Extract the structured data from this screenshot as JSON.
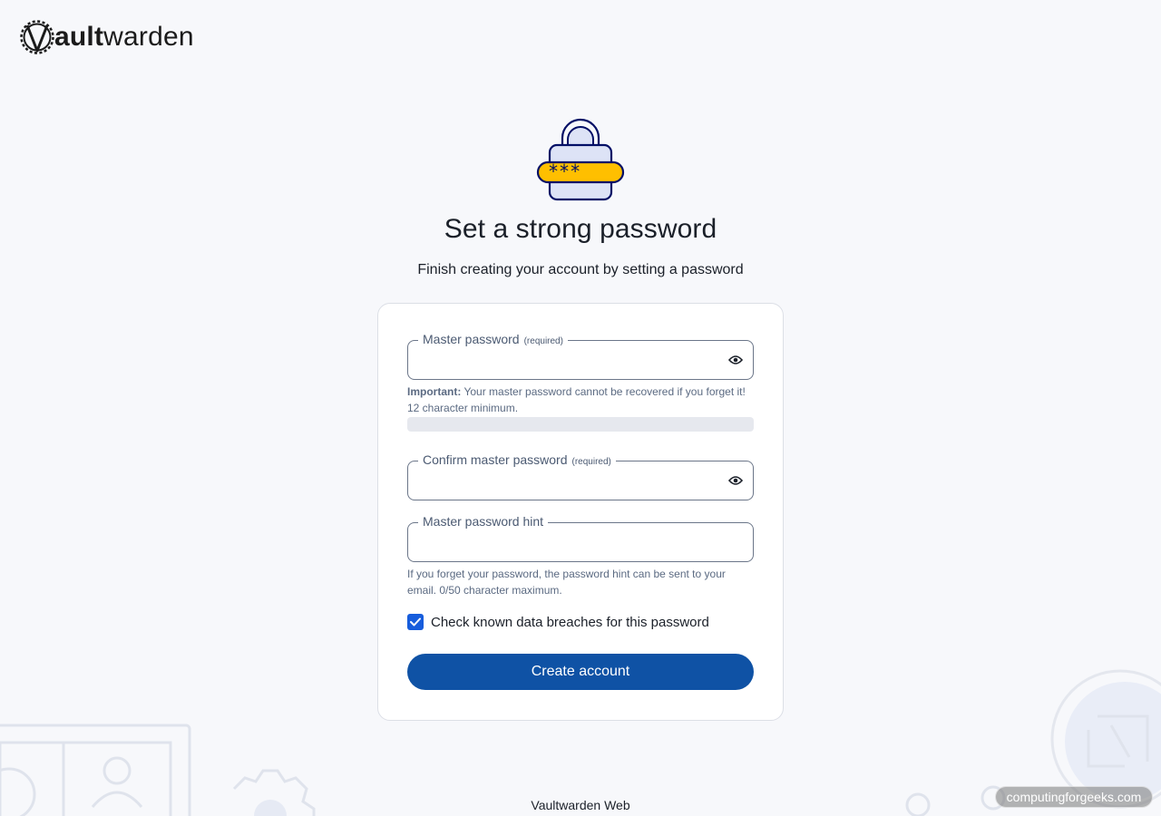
{
  "brand": {
    "logo_bold": "ault",
    "logo_light": "warden"
  },
  "page": {
    "title": "Set a strong password",
    "subtitle": "Finish creating your account by setting a password"
  },
  "form": {
    "master_password": {
      "label": "Master password",
      "required": "(required)",
      "value": ""
    },
    "master_password_help": {
      "important": "Important:",
      "text": " Your master password cannot be recovered if you forget it! 12 character minimum."
    },
    "confirm_password": {
      "label": "Confirm master password",
      "required": "(required)",
      "value": ""
    },
    "hint": {
      "label": "Master password hint",
      "value": "",
      "help": "If you forget your password, the password hint can be sent to your email. 0/50 character maximum."
    },
    "breach_check": {
      "label": "Check known data breaches for this password",
      "checked": true
    },
    "submit_label": "Create account"
  },
  "footer": {
    "text": "Vaultwarden Web"
  },
  "watermark": {
    "text": "computingforgeeks.com"
  },
  "colors": {
    "primary": "#0f52a5",
    "checkbox": "#175ddc",
    "lock_yellow": "#ffbf00",
    "lock_navy": "#020f66"
  },
  "icons": {
    "logo": "vaultwarden-gear-logo",
    "hero": "lock-password-icon",
    "eye": "eye-icon",
    "check": "check-icon"
  }
}
